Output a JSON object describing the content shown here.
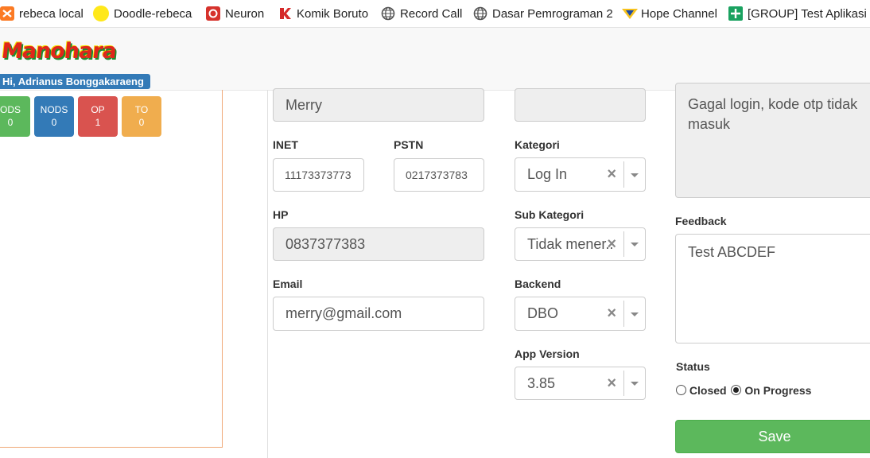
{
  "bookmarks": [
    {
      "label": "rebeca local",
      "icon": "xampp-icon"
    },
    {
      "label": "Doodle-rebeca",
      "icon": "yellow-circle-icon"
    },
    {
      "label": "Neuron",
      "icon": "neuron-icon"
    },
    {
      "label": "Komik Boruto",
      "icon": "komik-icon"
    },
    {
      "label": "Record Call",
      "icon": "globe-icon"
    },
    {
      "label": "Dasar Pemrograman 2",
      "icon": "globe-icon"
    },
    {
      "label": "Hope Channel",
      "icon": "hope-channel-icon"
    },
    {
      "label": "[GROUP] Test Aplikasi ...",
      "icon": "sheets-icon"
    }
  ],
  "brand": {
    "logo_text": "Manohara",
    "greeting": "Hi, Adrianus Bonggakaraeng"
  },
  "tiles": [
    {
      "label": "ODS",
      "count": "0",
      "color": "#5cb85c"
    },
    {
      "label": "NODS",
      "count": "0",
      "color": "#337ab7"
    },
    {
      "label": "OP",
      "count": "1",
      "color": "#d9534f"
    },
    {
      "label": "TO",
      "count": "0",
      "color": "#f0ad4e"
    }
  ],
  "form": {
    "name_value": "Merry",
    "top_mid_value": "",
    "inet_label": "INET",
    "inet_value": "11173373773",
    "pstn_label": "PSTN",
    "pstn_value": "0217373783",
    "hp_label": "HP",
    "hp_value": "0837377383",
    "email_label": "Email",
    "email_value": "merry@gmail.com",
    "kategori_label": "Kategori",
    "kategori_value": "Log In",
    "sub_kategori_label": "Sub Kategori",
    "sub_kategori_value": "Tidak mener...",
    "backend_label": "Backend",
    "backend_value": "DBO",
    "app_version_label": "App Version",
    "app_version_value": "3.85",
    "keluhan_value": "Gagal login, kode otp tidak masuk",
    "feedback_label": "Feedback",
    "feedback_value": "Test ABCDEF",
    "status_label": "Status",
    "status_closed": "Closed",
    "status_progress": "On Progress",
    "status_selected": "On Progress",
    "save_label": "Save"
  }
}
